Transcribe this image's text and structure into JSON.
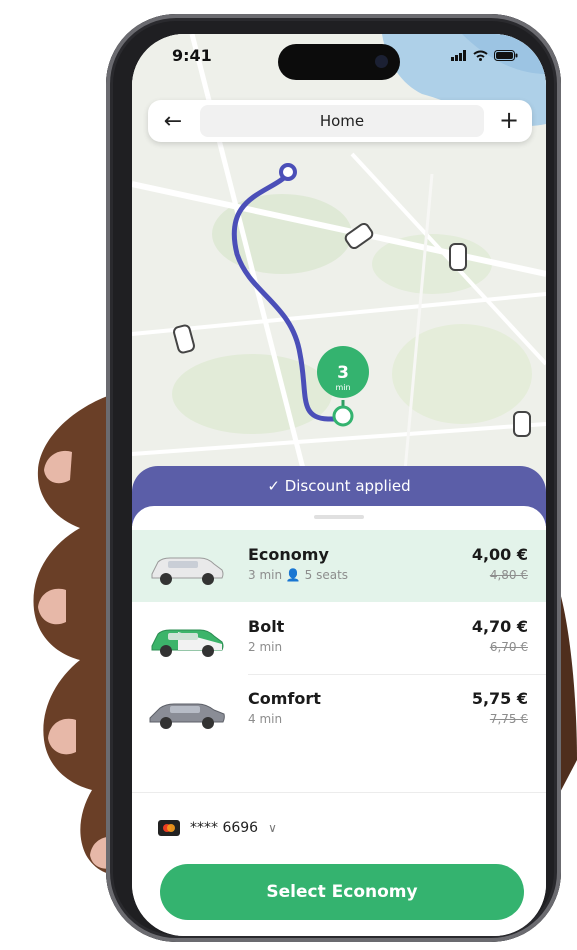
{
  "status_bar": {
    "time": "9:41"
  },
  "header": {
    "destination": "Home",
    "back_icon": "arrow-left-icon",
    "add_icon": "plus-icon"
  },
  "map": {
    "pickup_marker": {
      "eta_value": "3",
      "eta_unit": "min"
    }
  },
  "banner": {
    "text": "✓ Discount applied"
  },
  "rides": [
    {
      "name": "Economy",
      "meta": "3 min  👤 5 seats",
      "price": "4,00 €",
      "old_price": "4,80 €",
      "car_color": "#e9e9ea",
      "selected": true
    },
    {
      "name": "Bolt",
      "meta": "2 min",
      "price": "4,70 €",
      "old_price": "6,70 €",
      "car_color": "#3cb46a",
      "selected": false
    },
    {
      "name": "Comfort",
      "meta": "4 min",
      "price": "5,75 €",
      "old_price": "7,75 €",
      "car_color": "#8a8d96",
      "selected": false
    }
  ],
  "payment": {
    "card_mask": "**** 6696",
    "chevron_icon": "chevron-down-icon"
  },
  "cta": {
    "label": "Select Economy"
  },
  "colors": {
    "brand_green": "#34b36f",
    "banner_purple": "#5b5ea8",
    "route_blue": "#4b4fb8",
    "selected_row": "#e3f3ea"
  }
}
